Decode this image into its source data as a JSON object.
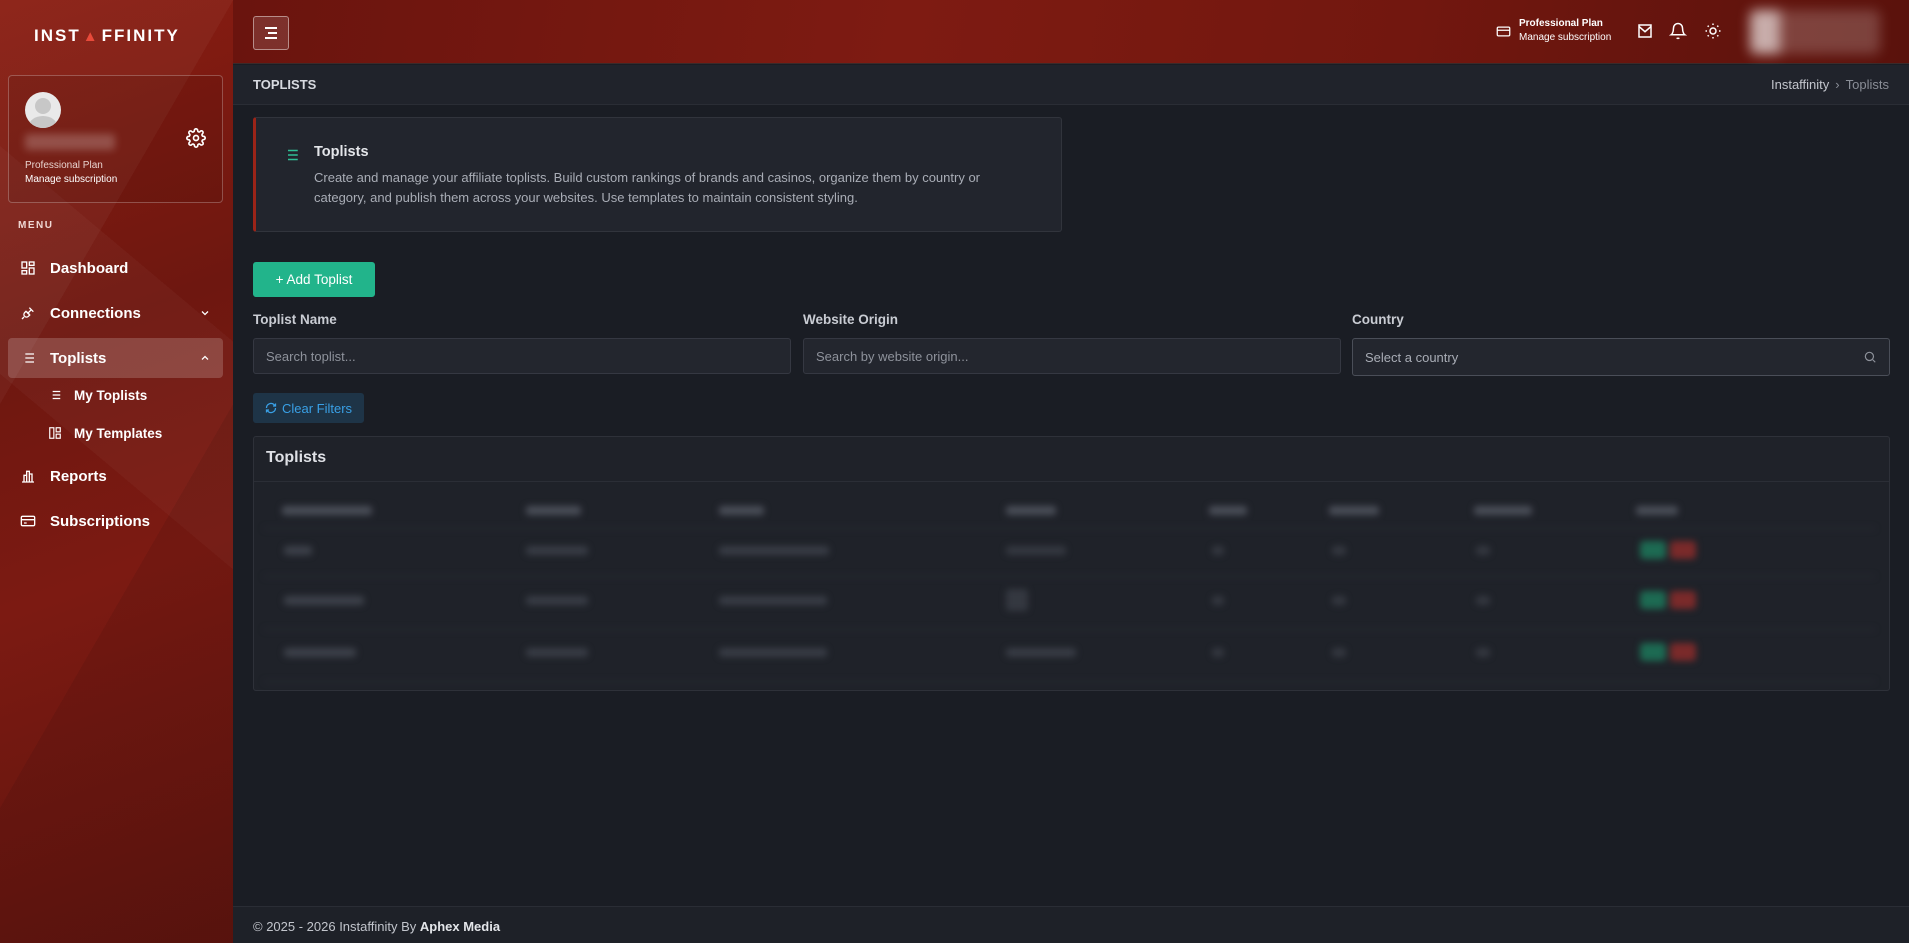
{
  "brand": {
    "logo_text_left": "INST",
    "logo_text_right": "FFINITY",
    "accent": "#22b48b",
    "sidebar_color": "#7a1a12"
  },
  "profile": {
    "plan": "Professional Plan",
    "manage": "Manage subscription"
  },
  "sidebar": {
    "menu_title": "MENU",
    "items": [
      {
        "label": "Dashboard",
        "icon": "dashboard-icon"
      },
      {
        "label": "Connections",
        "icon": "plug-icon"
      },
      {
        "label": "Toplists",
        "icon": "list-icon"
      },
      {
        "label": "Reports",
        "icon": "bar-chart-icon"
      },
      {
        "label": "Subscriptions",
        "icon": "card-icon"
      }
    ],
    "sub_items": [
      {
        "label": "My Toplists",
        "icon": "list-icon"
      },
      {
        "label": "My Templates",
        "icon": "template-icon"
      }
    ]
  },
  "topbar": {
    "plan": "Professional Plan",
    "manage": "Manage subscription"
  },
  "page": {
    "title": "TOPLISTS",
    "breadcrumb": [
      "Instaffinity",
      "Toplists"
    ]
  },
  "info": {
    "title": "Toplists",
    "text": "Create and manage your affiliate toplists. Build custom rankings of brands and casinos, organize them by country or category, and publish them across your websites. Use templates to maintain consistent styling."
  },
  "actions": {
    "add_toplist": "+ Add Toplist",
    "clear_filters": "Clear Filters"
  },
  "filters": {
    "toplist_name": {
      "label": "Toplist Name",
      "placeholder": "Search toplist..."
    },
    "website_origin": {
      "label": "Website Origin",
      "placeholder": "Search by website origin..."
    },
    "country": {
      "label": "Country",
      "placeholder": "Select a country"
    }
  },
  "table": {
    "title": "Toplists"
  },
  "footer": {
    "text": "© 2025 - 2026 Instaffinity By ",
    "company": "Aphex Media"
  }
}
